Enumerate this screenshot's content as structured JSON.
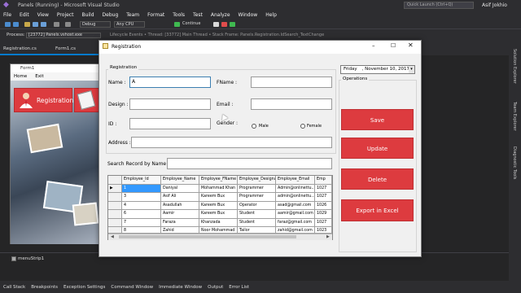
{
  "vs": {
    "title": "Panels (Running) - Microsoft Visual Studio",
    "quick_launch": "Quick Launch (Ctrl+Q)",
    "user": "Asif Jokhio",
    "menu": [
      "File",
      "Edit",
      "View",
      "Project",
      "Build",
      "Debug",
      "Team",
      "Format",
      "Tools",
      "Test",
      "Analyze",
      "Window",
      "Help"
    ],
    "toolbar": {
      "config": "Debug",
      "platform": "Any CPU",
      "continue": "Continue"
    },
    "process": {
      "label": "Process:",
      "value": "[23772] Panels.vshost.exe",
      "right_text": "Lifecycle Events  •  Thread: [33772] Main Thread  •  Stack Frame: Panels.Registration.IdSearch_TextChange"
    },
    "doc_tabs": [
      "Registration.cs",
      "Form1.cs"
    ],
    "right_rail": [
      "Solution Explorer",
      "Team Explorer",
      "Diagnostic Tools"
    ],
    "bottom_tabs": [
      "Call Stack",
      "Breakpoints",
      "Exception Settings",
      "Command Window",
      "Immediate Window",
      "Output",
      "Error List"
    ],
    "tray": {
      "menustrip": "menuStrip1"
    }
  },
  "form1": {
    "title": "Form1",
    "menu": [
      "Home",
      "Exit"
    ],
    "registration_button": "Registration"
  },
  "registration": {
    "title": "Registration",
    "group_label": "Registration",
    "fields": {
      "name_label": "Name :",
      "name_value": "A",
      "fname_label": "FName :",
      "design_label": "Design :",
      "email_label": "Email :",
      "id_label": "ID :",
      "gender_label": "Gender :",
      "male_label": "Male",
      "female_label": "Female",
      "address_label": "Address :"
    },
    "search_label": "Search Record by Name :",
    "date": {
      "day": "Friday",
      "date": ", November 10, 2017"
    },
    "operations_label": "Operations",
    "buttons": {
      "save": "Save",
      "update": "Update",
      "delete": "Delete",
      "export": "Export in Excel"
    },
    "grid": {
      "columns": [
        "Employee_Id",
        "Employee_Name",
        "Employee_FName",
        "Employee_Designa",
        "Employee_Email",
        "Emp"
      ],
      "rows": [
        [
          "1",
          "Daniyal",
          "Mohammad Khan",
          "Programmer",
          "Admin@onlinettu...",
          "1027"
        ],
        [
          "3",
          "Asif Ali",
          "Kareem Bux",
          "Programmer",
          "admin@onlinettu...",
          "1027"
        ],
        [
          "4",
          "Asadullah",
          "Kareem Bux",
          "Operator",
          "asad@gmail.com",
          "1026"
        ],
        [
          "6",
          "Aamir",
          "Kareem Bux",
          "Student",
          "aamir@gmail.com",
          "1029"
        ],
        [
          "7",
          "Faraza",
          "Khanzada",
          "Student",
          "faraz@gmail.com",
          "1027"
        ],
        [
          "8",
          "Zahid",
          "Noor Mohammad",
          "Tailor",
          "zahid@gmail.com",
          "1023"
        ]
      ]
    }
  },
  "colors": {
    "accent": "#dd3b3f",
    "vs_bg": "#2d2d30",
    "vs_blue": "#007acc"
  }
}
